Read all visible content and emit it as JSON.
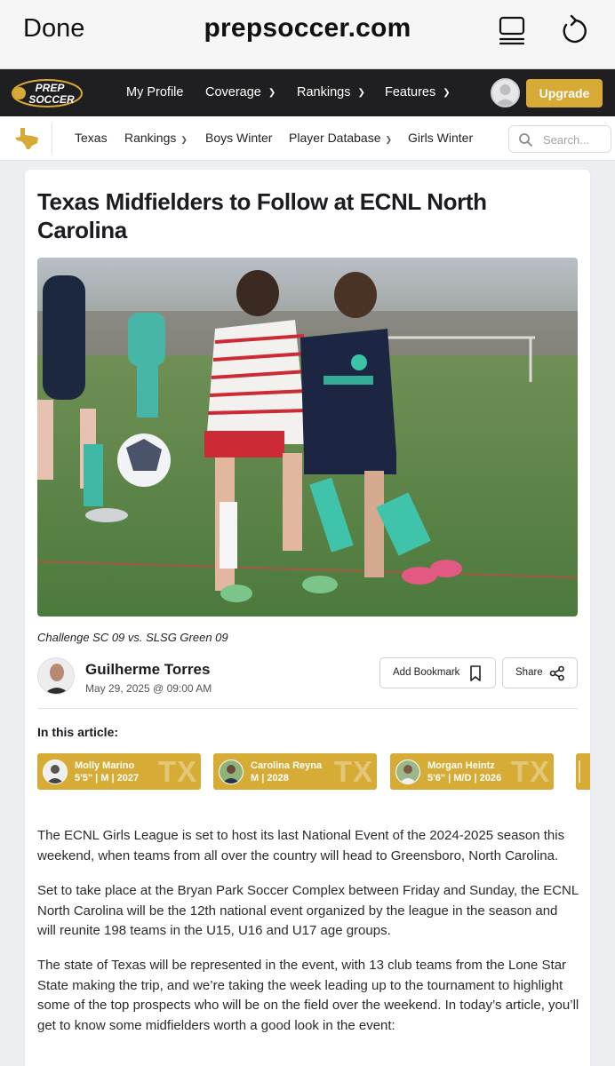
{
  "browser": {
    "done_label": "Done",
    "url": "prepsoccer.com"
  },
  "site_nav": {
    "logo_text_top": "PREP",
    "logo_text_bottom": "SOCCER",
    "items": [
      {
        "label": "My Profile"
      },
      {
        "label": "Coverage"
      },
      {
        "label": "Rankings"
      },
      {
        "label": "Features"
      }
    ],
    "upgrade_label": "Upgrade"
  },
  "sub_nav": {
    "items": [
      {
        "label": "Texas"
      },
      {
        "label": "Rankings"
      },
      {
        "label": "Boys Winter"
      },
      {
        "label": "Player Database"
      },
      {
        "label": "Girls Winter"
      }
    ],
    "search_placeholder": "Search..."
  },
  "article": {
    "title": "Texas Midfielders to Follow at ECNL North Carolina",
    "caption": "Challenge SC 09 vs. SLSG Green 09",
    "author": {
      "name": "Guilherme Torres",
      "date": "May 29, 2025 @ 09:00 AM"
    },
    "actions": {
      "bookmark_label": "Add Bookmark",
      "share_label": "Share"
    },
    "in_this_article_label": "In this article:",
    "players": [
      {
        "name": "Molly Marino",
        "info": "5'5\" | M | 2027",
        "state": "TX"
      },
      {
        "name": "Carolina Reyna",
        "info": "M | 2028",
        "state": "TX"
      },
      {
        "name": "Morgan Heintz",
        "info": "5'6\" | M/D | 2026",
        "state": "TX"
      }
    ],
    "paragraphs": [
      "The ECNL Girls League is set to host its last National Event of the 2024-2025 season this weekend, when teams from all over the country will head to Greensboro, North Carolina.",
      "Set to take place at the Bryan Park Soccer Complex between Friday and Sunday, the ECNL North Carolina will be the 12th national event organized by the league in the season and will reunite 198 teams in the U15, U16 and U17 age groups.",
      "The state of Texas will be represented in the event, with 13 club teams from the Lone Star State making the trip, and we’re taking the week leading up to the tournament to highlight some of the top prospects who will be on the field over the weekend. In today’s article, you’ll get to know some midfielders worth a good look in the event:"
    ]
  },
  "colors": {
    "nav_bg": "#1f1f21",
    "accent_gold": "#d7a935",
    "player_card_gold": "#d6ac37",
    "page_bg": "#eceef1"
  }
}
